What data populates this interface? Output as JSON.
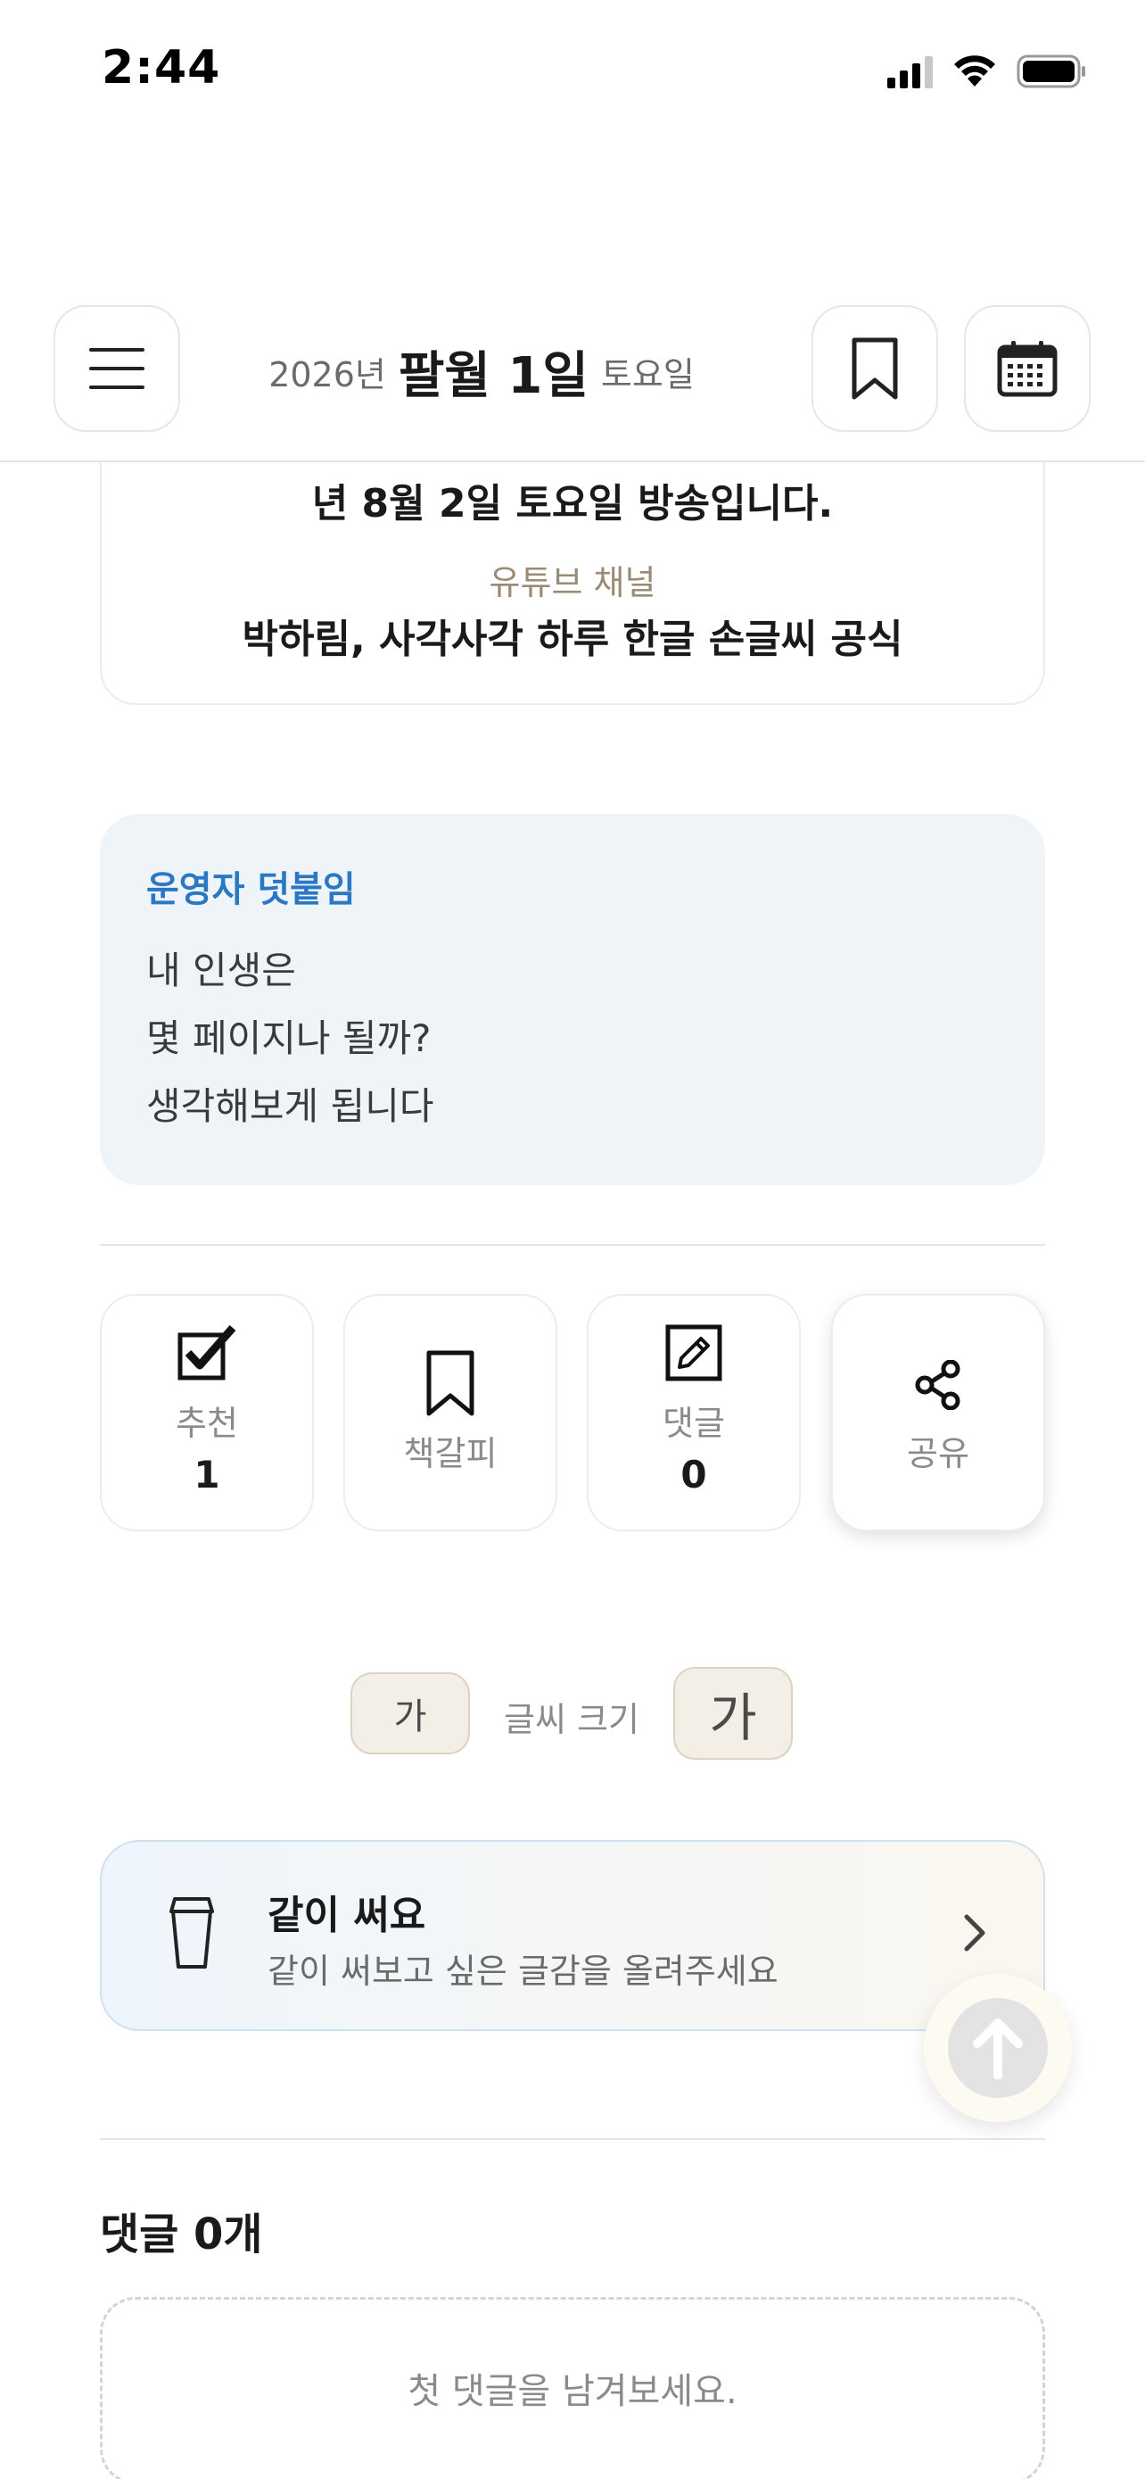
{
  "status_bar": {
    "time": "2:44"
  },
  "header": {
    "year": "2026년",
    "date": "팔월 1일",
    "weekday": "토요일"
  },
  "broadcast": {
    "line": "년 8월 2일 토요일 방송입니다.",
    "youtube_label": "유튜브 채널",
    "channel_name": "박하림, 사각사각 하루 한글 손글씨 공식"
  },
  "operator_note": {
    "title": "운영자 덧붙임",
    "lines": [
      "내 인생은",
      "몇 페이지나 될까?",
      "생각해보게 됩니다"
    ]
  },
  "actions": {
    "recommend": {
      "label": "추천",
      "count": "1"
    },
    "bookmark": {
      "label": "책갈피"
    },
    "comment": {
      "label": "댓글",
      "count": "0"
    },
    "share": {
      "label": "공유"
    }
  },
  "font_size": {
    "small_label": "가",
    "label": "글씨 크기",
    "large_label": "가"
  },
  "write_together": {
    "title": "같이 써요",
    "subtitle": "같이 써보고 싶은 글감을 올려주세요"
  },
  "comments": {
    "title": "댓글 0개",
    "empty_text": "첫 댓글을 남겨보세요."
  },
  "colors": {
    "accent_blue": "#2a78c4",
    "note_background": "#eff4f8",
    "channel_label": "#9a8b74",
    "font_button_background": "#f3eee6"
  },
  "icons": {
    "menu": "hamburger-icon",
    "bookmark": "bookmark-icon",
    "calendar": "calendar-icon",
    "recommend": "checkbox-check-icon",
    "comment": "pencil-square-icon",
    "share": "share-icon",
    "write": "cup-icon",
    "chevron": "chevron-right-icon",
    "scroll_top": "arrow-up-icon"
  }
}
